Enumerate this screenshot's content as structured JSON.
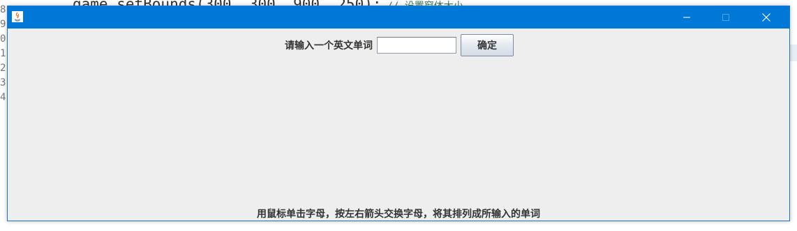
{
  "background": {
    "code_line": "game.setBounds(300, 300, 900, 250);",
    "code_comment": "// 设置窗体大小",
    "gutter_digits": [
      "8",
      "9",
      "0",
      "1",
      "2",
      "3",
      "4"
    ]
  },
  "window": {
    "title": "",
    "app_icon": "java-icon",
    "titlebar_color": "#0078d7",
    "controls": {
      "minimize_icon": "minimize-icon",
      "maximize_icon": "maximize-icon",
      "close_icon": "close-icon"
    }
  },
  "form": {
    "prompt_label": "请输入一个英文单词",
    "input_value": "",
    "confirm_label": "确定"
  },
  "hint": {
    "text": "用鼠标单击字母，按左右箭头交换字母，将其排列成所输入的单词"
  }
}
